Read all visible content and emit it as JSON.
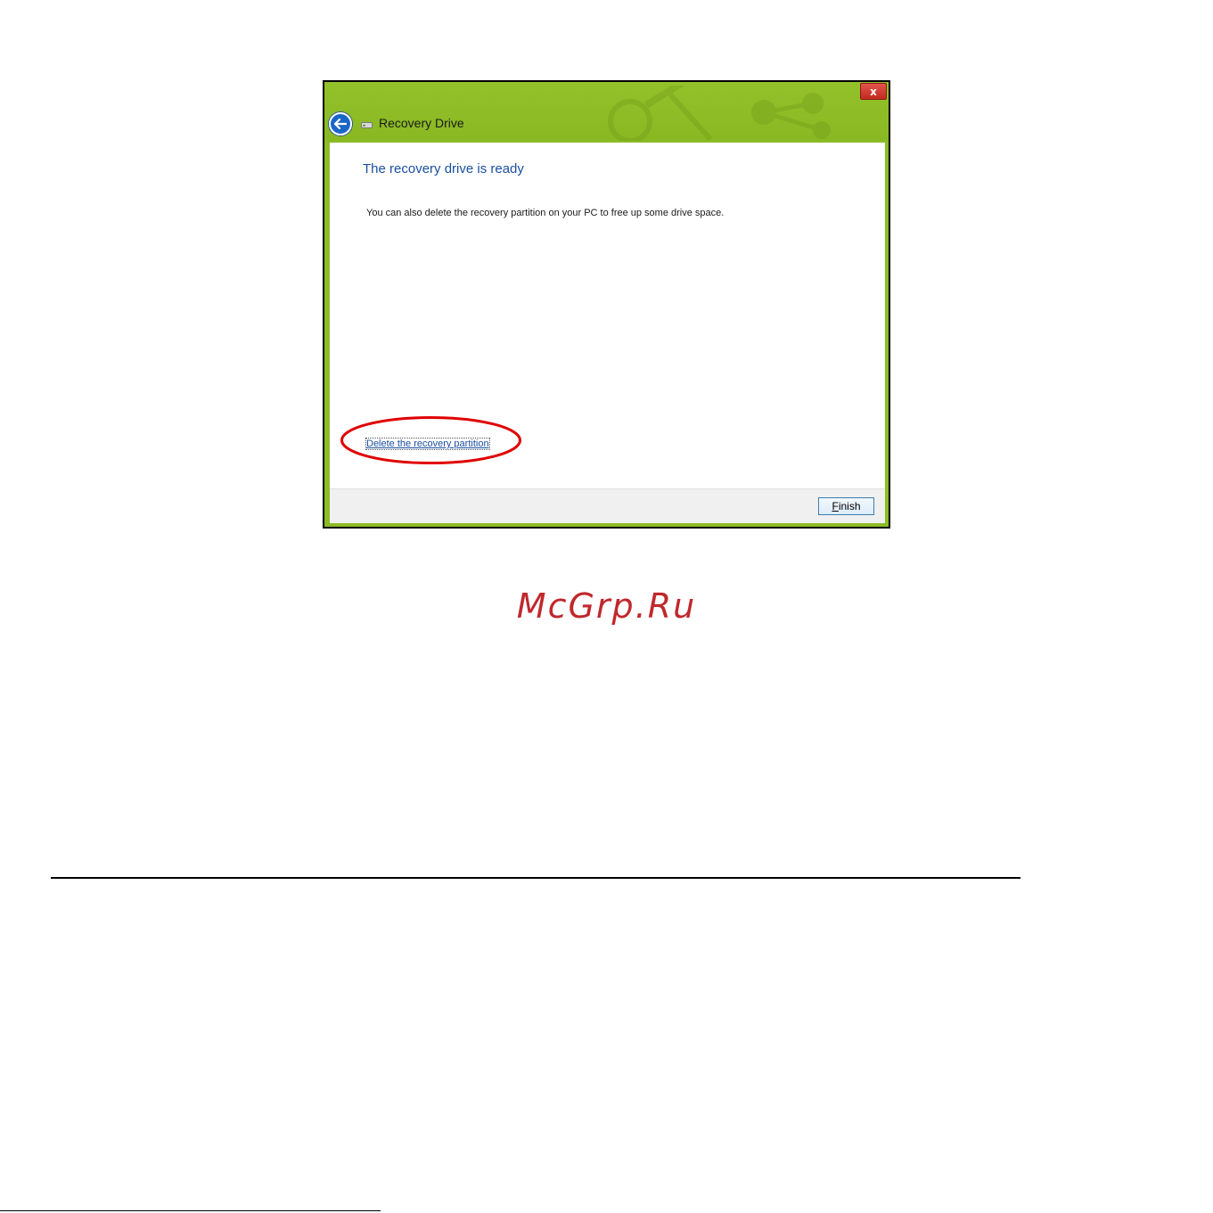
{
  "window": {
    "title": "Recovery Drive",
    "close_label": "x",
    "back_icon": "back-arrow-icon",
    "drive_icon": "usb-drive-icon"
  },
  "content": {
    "heading": "The recovery drive is ready",
    "body": "You can also delete the recovery partition on your PC to free up some drive space.",
    "link_label": "Delete the recovery partition"
  },
  "footer": {
    "finish_mnemonic": "F",
    "finish_rest": "inish"
  },
  "watermark": "McGrp.Ru",
  "colors": {
    "title_bar": "#8cbc26",
    "heading": "#1a4fa0",
    "highlight": "#e00000",
    "watermark": "#c0282d"
  }
}
